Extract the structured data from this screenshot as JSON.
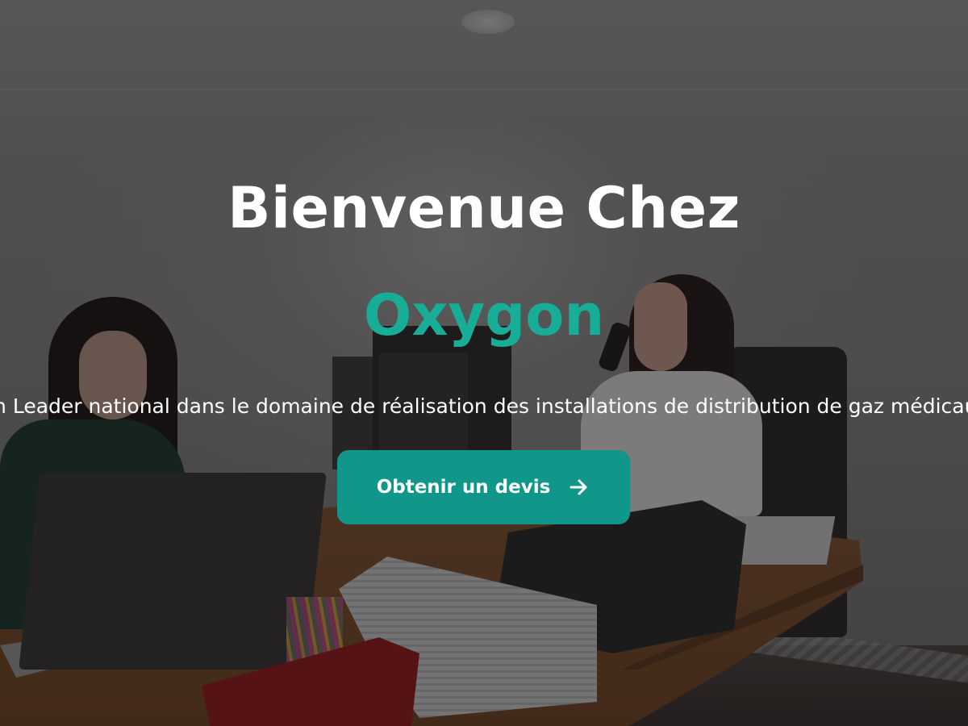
{
  "hero": {
    "title_line1": "Bienvenue Chez",
    "title_line2": "Oxygon",
    "subtitle": "Un Leader national dans le domaine de réalisation des installations de distribution de gaz médicaux",
    "cta_label": "Obtenir un devis",
    "cta_icon": "arrow-right-icon"
  },
  "colors": {
    "accent": "#17ad97",
    "button_bg": "#11968a",
    "title": "#ffffff"
  },
  "background": {
    "image": "office-photo",
    "overlay": "dark"
  }
}
